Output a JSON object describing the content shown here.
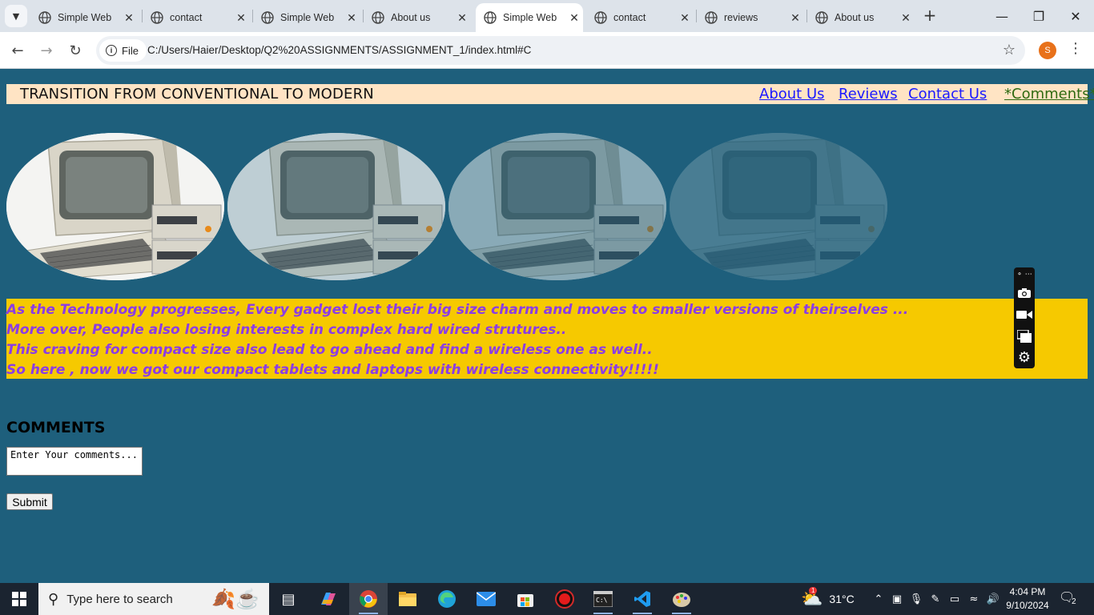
{
  "browser": {
    "tabs": [
      {
        "label": "Simple Web",
        "active": false
      },
      {
        "label": "contact",
        "active": false
      },
      {
        "label": "Simple Web",
        "active": false
      },
      {
        "label": "About us",
        "active": false
      },
      {
        "label": "Simple Web",
        "active": true
      },
      {
        "label": "contact",
        "active": false
      },
      {
        "label": "reviews",
        "active": false
      },
      {
        "label": "About us",
        "active": false
      }
    ],
    "site_info_label": "File",
    "url": "C:/Users/Haier/Desktop/Q2%20ASSIGNMENTS/ASSIGNMENT_1/index.html#C",
    "profile_initial": "S"
  },
  "page": {
    "title": "TRANSITION FROM CONVENTIONAL TO MODERN",
    "nav": [
      {
        "label": "About Us",
        "color": "#1a1aff"
      },
      {
        "label": "Reviews",
        "color": "#1a1aff"
      },
      {
        "label": "Contact Us",
        "color": "#1a1aff"
      },
      {
        "label": "*Comments*",
        "color": "#2f6b12"
      }
    ],
    "images": [
      {
        "opacity_level": 1.0
      },
      {
        "opacity_level": 0.75
      },
      {
        "opacity_level": 0.5
      },
      {
        "opacity_level": 0.2
      }
    ],
    "banner_lines": [
      "As the Technology progresses, Every gadget lost their big size charm and moves to smaller versions of theirselves ...",
      "More over, People also losing interests in complex hard wired strutures..",
      "This craving for compact size also lead to go ahead and find a wireless one as well..",
      "So here , now we got our compact tablets and laptops with wireless connectivity!!!!!"
    ],
    "comments_heading": "COMMENTS",
    "comment_placeholder": "Enter Your comments...",
    "submit_label": "Submit",
    "colors": {
      "background": "#1e5f7c",
      "navbar": "#ffe4c4",
      "banner": "#f6c900",
      "banner_text": "#8b3ce6"
    }
  },
  "taskbar": {
    "search_placeholder": "Type here to search",
    "weather_temp": "31°C",
    "weather_badge": "1",
    "time": "4:04 PM",
    "date": "9/10/2024",
    "notification_count": "2"
  }
}
